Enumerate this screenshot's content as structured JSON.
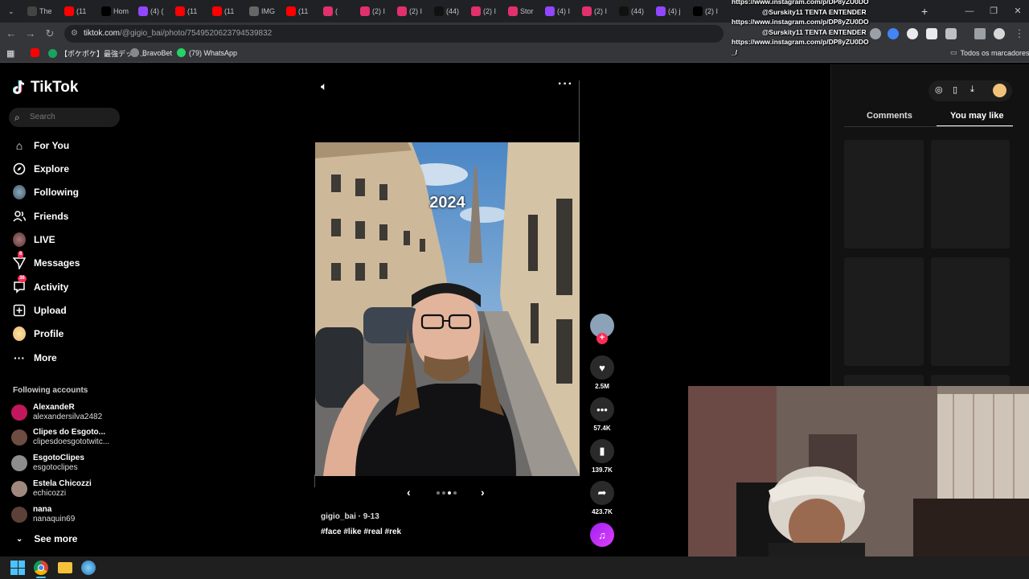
{
  "browser": {
    "tabs": [
      {
        "icon": "threads-icon",
        "label": "The",
        "color": "#444"
      },
      {
        "icon": "youtube-icon",
        "label": "(11",
        "color": "#ff0000"
      },
      {
        "icon": "x-icon",
        "label": "Hom",
        "color": "#000"
      },
      {
        "icon": "twitch-icon",
        "label": "(4) (",
        "color": "#9146ff"
      },
      {
        "icon": "youtube-icon",
        "label": "(11",
        "color": "#ff0000"
      },
      {
        "icon": "youtube-icon",
        "label": "(11",
        "color": "#ff0000"
      },
      {
        "icon": "globe-icon",
        "label": "IMG",
        "color": "#666"
      },
      {
        "icon": "youtube-icon",
        "label": "(11",
        "color": "#ff0000"
      },
      {
        "icon": "instagram-icon",
        "label": "(",
        "color": "#e1306c"
      },
      {
        "icon": "instagram-icon",
        "label": "(2) I",
        "color": "#e1306c"
      },
      {
        "icon": "instagram-icon",
        "label": "(2) I",
        "color": "#e1306c"
      },
      {
        "icon": "tiktok-icon",
        "label": "(44)",
        "color": "#111"
      },
      {
        "icon": "instagram-icon",
        "label": "(2) I",
        "color": "#e1306c"
      },
      {
        "icon": "instagram-icon",
        "label": "Stor",
        "color": "#e1306c"
      },
      {
        "icon": "twitch-icon",
        "label": "(4) I",
        "color": "#9146ff"
      },
      {
        "icon": "instagram-icon",
        "label": "(2) I",
        "color": "#e1306c"
      },
      {
        "icon": "tiktok-icon",
        "label": "(44)",
        "color": "#111"
      },
      {
        "icon": "twitch-icon",
        "label": "(4) j",
        "color": "#9146ff"
      },
      {
        "icon": "x-icon",
        "label": "(2) I",
        "color": "#000"
      }
    ],
    "url_host": "tiktok.com",
    "url_path": "/@gigio_bai/photo/7549520623794539832",
    "bookmarks": [
      {
        "label": "",
        "color": "#ff0000"
      },
      {
        "label": "【ポケポケ】最強デッキ...",
        "color": "#1aa260"
      },
      {
        "label": "BravoBet",
        "color": "#888"
      },
      {
        "label": "(79) WhatsApp",
        "color": "#25d366"
      }
    ],
    "all_bookmarks": "Todos os marcadores"
  },
  "overlay": {
    "lines": [
      "https://www.instagram.com/p/DP8yZU0DO",
      "@Surskity11 TENTA ENTENDER",
      "https://www.instagram.com/p/DP8yZU0DO",
      "@Surskity11 TENTA ENTENDER",
      "https://www.instagram.com/p/DP8yZU0DO",
      "_/"
    ]
  },
  "sidebar": {
    "logo": "TikTok",
    "search_placeholder": "Search",
    "items": [
      {
        "label": "For You",
        "icon": "home-icon"
      },
      {
        "label": "Explore",
        "icon": "compass-icon"
      },
      {
        "label": "Following",
        "icon": "following-avatar-icon"
      },
      {
        "label": "Friends",
        "icon": "friends-icon"
      },
      {
        "label": "LIVE",
        "icon": "live-avatar-icon"
      },
      {
        "label": "Messages",
        "icon": "messages-icon",
        "badge": "8"
      },
      {
        "label": "Activity",
        "icon": "activity-icon",
        "badge": "36"
      },
      {
        "label": "Upload",
        "icon": "upload-icon"
      },
      {
        "label": "Profile",
        "icon": "profile-avatar-icon"
      },
      {
        "label": "More",
        "icon": "more-icon"
      }
    ],
    "following_header": "Following accounts",
    "following": [
      {
        "name": "AlexandeR",
        "username": "alexandersilva2482",
        "color": "#c2185b"
      },
      {
        "name": "Clipes do Esgoto...",
        "username": "clipesdoesgototwitc...",
        "color": "#6d4c41"
      },
      {
        "name": "EsgotoClipes",
        "username": "esgotoclipes",
        "color": "#8d8d8d"
      },
      {
        "name": "Estela Chicozzi",
        "username": "echicozzi",
        "color": "#a1887f"
      },
      {
        "name": "nana",
        "username": "nanaquin69",
        "color": "#5d4037"
      }
    ],
    "see_more": "See more"
  },
  "post": {
    "photo_text": "2024",
    "author": "gigio_bai · 9-13",
    "tags": "#face #like #real #rek",
    "carousel_dots": 4,
    "active_dot": 3,
    "likes": "2.5M",
    "comments": "57.4K",
    "saves": "139.7K",
    "shares": "423.7K"
  },
  "right_panel": {
    "tab_comments": "Comments",
    "tab_you_may_like": "You may like"
  }
}
